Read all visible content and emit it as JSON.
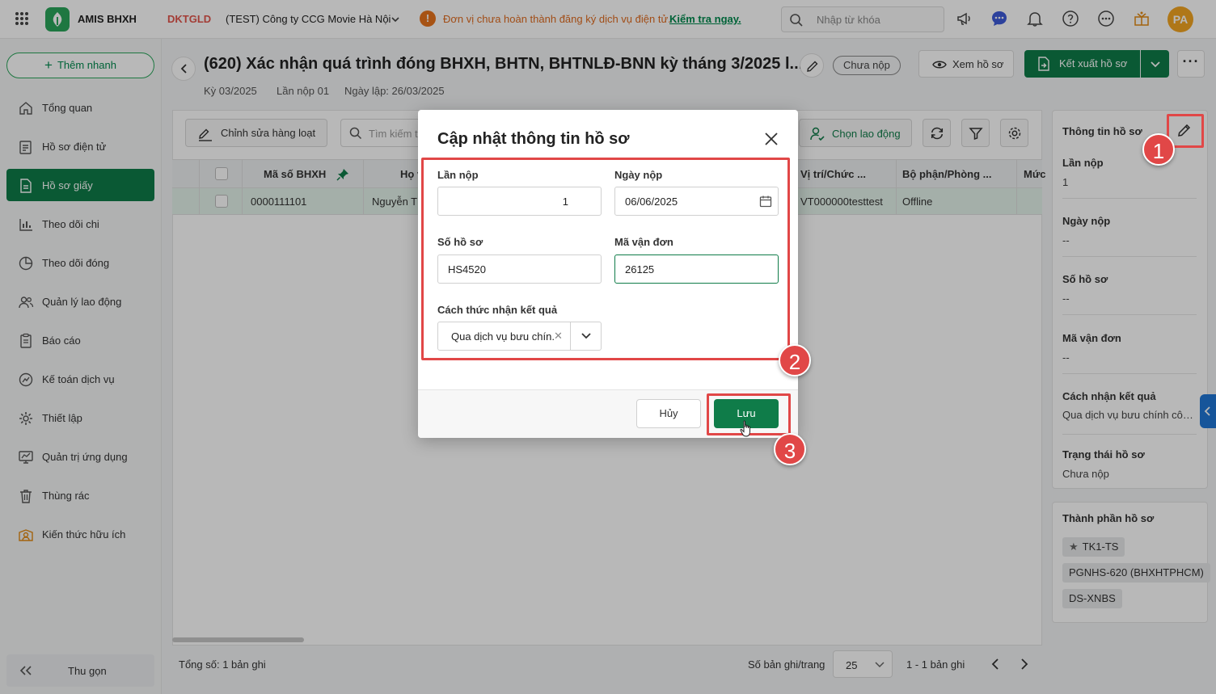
{
  "topbar": {
    "app_name": "AMIS BHXH",
    "tenant_code": "DKTGLD",
    "company": "(TEST) Công ty CCG Movie Hà Nội",
    "warning_text": "Đơn vị chưa hoàn thành đăng ký dịch vụ điện tử.",
    "warning_link": "Kiểm tra ngay.",
    "search_placeholder": "Nhập từ khóa",
    "avatar_initials": "PA",
    "icons": [
      "megaphone-icon",
      "chat-icon",
      "bell-icon",
      "help-icon",
      "more-icon",
      "gift-icon"
    ]
  },
  "sidebar": {
    "quick_add": "Thêm nhanh",
    "items": [
      {
        "label": "Tổng quan",
        "icon": "home-icon"
      },
      {
        "label": "Hồ sơ điện tử",
        "icon": "e-document-icon"
      },
      {
        "label": "Hồ sơ giấy",
        "icon": "paper-document-icon",
        "active": true
      },
      {
        "label": "Theo dõi chi",
        "icon": "bar-chart-icon"
      },
      {
        "label": "Theo dõi đóng",
        "icon": "pie-chart-icon"
      },
      {
        "label": "Quản lý lao động",
        "icon": "users-icon"
      },
      {
        "label": "Báo cáo",
        "icon": "report-icon"
      },
      {
        "label": "Kế toán dịch vụ",
        "icon": "accounting-icon"
      },
      {
        "label": "Thiết lập",
        "icon": "settings-icon"
      },
      {
        "label": "Quản trị ứng dụng",
        "icon": "admin-icon"
      },
      {
        "label": "Thùng rác",
        "icon": "trash-icon"
      },
      {
        "label": "Kiến thức hữu ích",
        "icon": "knowledge-icon"
      }
    ],
    "collapse_label": "Thu gọn"
  },
  "page": {
    "title": "(620) Xác nhận quá trình đóng BHXH, BHTN, BHTNLĐ-BNN kỳ tháng 3/2025 l...",
    "status": "Chưa nộp",
    "period": "Kỳ 03/2025",
    "submission": "Lần nộp 01",
    "created_date": "Ngày lập: 26/03/2025",
    "view_button": "Xem hồ sơ",
    "export_button": "Kết xuất hồ sơ"
  },
  "grid": {
    "bulk_edit": "Chỉnh sửa hàng loạt",
    "search_placeholder": "Tìm kiếm t",
    "choose_employee": "Chọn lao động",
    "columns": [
      "Mã số BHXH",
      "Họ v",
      "Vị trí/Chức ...",
      "Bộ phận/Phòng ...",
      "Mức"
    ],
    "rows": [
      {
        "code": "0000111101",
        "name": "Nguyễn Th",
        "position": "VT000000testtest",
        "department": "Offline"
      }
    ],
    "total": "Tổng số: 1 bản ghi",
    "page_size_label": "Số bản ghi/trang",
    "page_size": "25",
    "range": "1 - 1 bản ghi"
  },
  "right_panel": {
    "title": "Thông tin hồ sơ",
    "fields": [
      {
        "label": "Lần nộp",
        "value": "1"
      },
      {
        "label": "Ngày nộp",
        "value": "--"
      },
      {
        "label": "Số hồ sơ",
        "value": "--"
      },
      {
        "label": "Mã vận đơn",
        "value": "--"
      },
      {
        "label": "Cách nhận kết quả",
        "value": "Qua dịch vụ bưu chính công ích"
      },
      {
        "label": "Trạng thái hồ sơ",
        "value": "Chưa nộp"
      }
    ],
    "components_title": "Thành phần hồ sơ",
    "components": [
      "TK1-TS",
      "PGNHS-620 (BHXHTPHCM)",
      "DS-XNBS"
    ]
  },
  "modal": {
    "title": "Cập nhật thông tin hồ sơ",
    "submission_label": "Lần nộp",
    "submission_value": "1",
    "date_label": "Ngày nộp",
    "date_value": "06/06/2025",
    "record_no_label": "Số hồ sơ",
    "record_no_value": "HS4520",
    "tracking_label": "Mã vận đơn",
    "tracking_value": "26125",
    "delivery_label": "Cách thức nhận kết quả",
    "delivery_value": "Qua dịch vụ bưu chín.",
    "cancel": "Hủy",
    "save": "Lưu"
  },
  "annotations": {
    "step1": "1",
    "step2": "2",
    "step3": "3",
    "color": "#e14747"
  }
}
